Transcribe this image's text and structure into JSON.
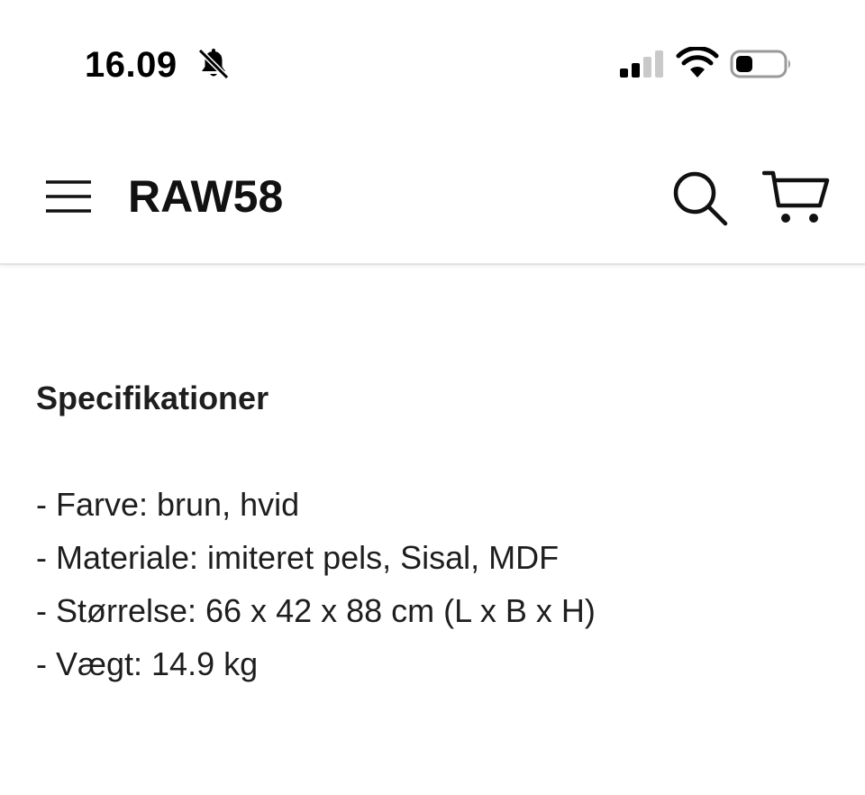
{
  "status_bar": {
    "time": "16.09",
    "icons": [
      "bell-slash-icon",
      "cellular-signal-icon",
      "wifi-icon",
      "battery-icon"
    ],
    "signal_bars_active": 2,
    "signal_bars_total": 4,
    "battery_level": 0.35
  },
  "header": {
    "menu_icon": "hamburger-icon",
    "brand": "RAW58",
    "search_icon": "search-icon",
    "cart_icon": "cart-icon"
  },
  "specs": {
    "heading": "Specifikationer",
    "items": [
      "- Farve: brun, hvid",
      "- Materiale: imiteret pels, Sisal, MDF",
      "- Størrelse: 66 x 42 x 88 cm (L x B x H)",
      "- Vægt: 14.9 kg"
    ]
  },
  "colors": {
    "background": "#ffffff",
    "text": "#1e1e1e",
    "header_border": "#e2e2e2"
  }
}
